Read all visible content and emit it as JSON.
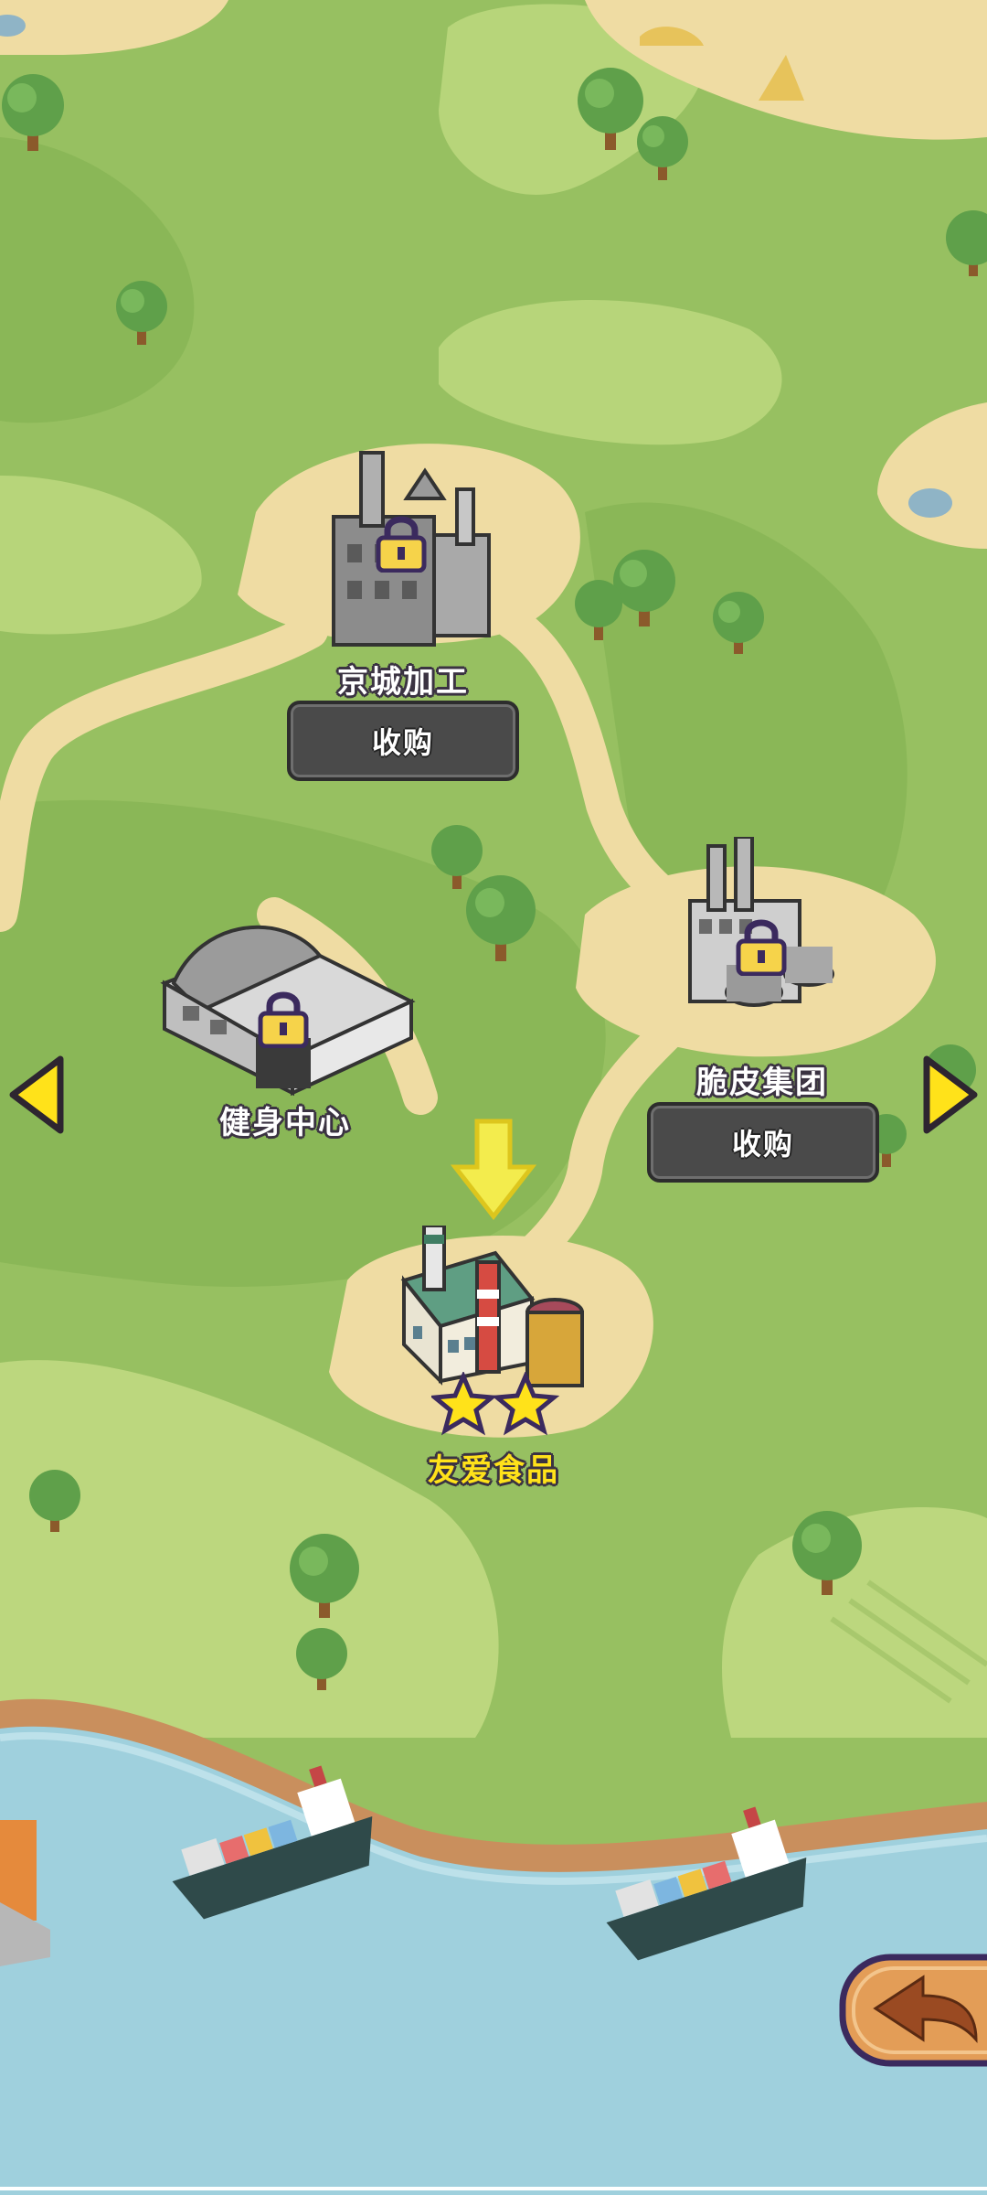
{
  "buildings": [
    {
      "name": "京城加工",
      "locked": true,
      "button": "收购"
    },
    {
      "name": "健身中心",
      "locked": true
    },
    {
      "name": "脆皮集团",
      "locked": true,
      "button": "收购"
    },
    {
      "name": "友爱食品",
      "locked": false,
      "stars": 2
    }
  ],
  "nav": {
    "prev_icon": "arrow-left-icon",
    "next_icon": "arrow-right-icon",
    "back_icon": "back-arrow-icon"
  },
  "colors": {
    "grass": "#97c061",
    "sand": "#efdca3",
    "sea": "#9fd0dd",
    "active_label": "#ffe21a",
    "locked_button": "#4a4a4a"
  }
}
